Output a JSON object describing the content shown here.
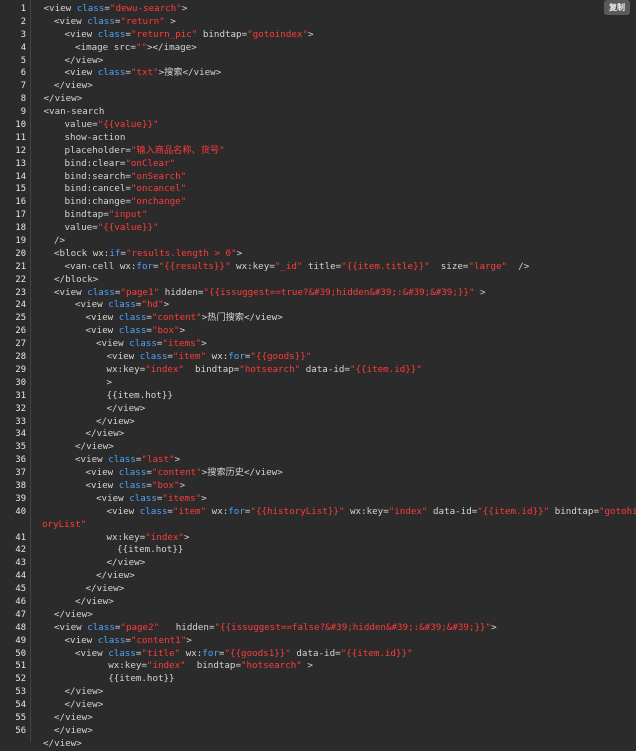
{
  "copy_label": "复制",
  "colors": {
    "background": "#2b2b2b",
    "text": "#d4d4d4",
    "keyword": "#4da3ff",
    "string": "#ff3b3b"
  },
  "lines": [
    {
      "n": "1",
      "indent": 1,
      "tokens": [
        [
          "t",
          "<view "
        ],
        [
          "k",
          "class"
        ],
        [
          "t",
          "="
        ],
        [
          "s",
          "\"dewu-search\""
        ],
        [
          "t",
          ">"
        ]
      ]
    },
    {
      "n": "2",
      "indent": 2,
      "tokens": [
        [
          "t",
          "<view "
        ],
        [
          "k",
          "class"
        ],
        [
          "t",
          "="
        ],
        [
          "s",
          "\"return\""
        ],
        [
          "t",
          " >"
        ]
      ]
    },
    {
      "n": "3",
      "indent": 3,
      "tokens": [
        [
          "t",
          "<view "
        ],
        [
          "k",
          "class"
        ],
        [
          "t",
          "="
        ],
        [
          "s",
          "\"return_pic\""
        ],
        [
          "t",
          " bindtap="
        ],
        [
          "s",
          "\"gotoindex\""
        ],
        [
          "t",
          ">"
        ]
      ]
    },
    {
      "n": "4",
      "indent": 4,
      "tokens": [
        [
          "t",
          "<image src="
        ],
        [
          "s",
          "\"\""
        ],
        [
          "t",
          "></image>"
        ]
      ]
    },
    {
      "n": "5",
      "indent": 3,
      "tokens": [
        [
          "t",
          "</view>"
        ]
      ]
    },
    {
      "n": "6",
      "indent": 3,
      "tokens": [
        [
          "t",
          "<view "
        ],
        [
          "k",
          "class"
        ],
        [
          "t",
          "="
        ],
        [
          "s",
          "\"txt\""
        ],
        [
          "t",
          ">搜索</view>"
        ]
      ]
    },
    {
      "n": "7",
      "indent": 2,
      "tokens": [
        [
          "t",
          "</view>"
        ]
      ]
    },
    {
      "n": "8",
      "indent": 1,
      "tokens": [
        [
          "t",
          "</view>"
        ]
      ]
    },
    {
      "n": "9",
      "indent": 1,
      "tokens": [
        [
          "t",
          "<van-search"
        ]
      ]
    },
    {
      "n": "10",
      "indent": 3,
      "tokens": [
        [
          "t",
          "value="
        ],
        [
          "s",
          "\"{{value}}\""
        ]
      ]
    },
    {
      "n": "11",
      "indent": 3,
      "tokens": [
        [
          "t",
          "show-action"
        ]
      ]
    },
    {
      "n": "12",
      "indent": 3,
      "tokens": [
        [
          "t",
          "placeholder="
        ],
        [
          "s",
          "\"输入商品名称、货号\""
        ]
      ]
    },
    {
      "n": "13",
      "indent": 3,
      "tokens": [
        [
          "t",
          "bind:clear="
        ],
        [
          "s",
          "\"onClear\""
        ]
      ]
    },
    {
      "n": "14",
      "indent": 3,
      "tokens": [
        [
          "t",
          "bind:search="
        ],
        [
          "s",
          "\"onSearch\""
        ]
      ]
    },
    {
      "n": "15",
      "indent": 3,
      "tokens": [
        [
          "t",
          "bind:cancel="
        ],
        [
          "s",
          "\"oncancel\""
        ]
      ]
    },
    {
      "n": "16",
      "indent": 3,
      "tokens": [
        [
          "t",
          "bind:change="
        ],
        [
          "s",
          "\"onchange\""
        ]
      ]
    },
    {
      "n": "17",
      "indent": 3,
      "tokens": [
        [
          "t",
          "bindtap="
        ],
        [
          "s",
          "\"input\""
        ]
      ]
    },
    {
      "n": "18",
      "indent": 3,
      "tokens": [
        [
          "t",
          "value="
        ],
        [
          "s",
          "\"{{value}}\""
        ]
      ]
    },
    {
      "n": "19",
      "indent": 2,
      "tokens": [
        [
          "t",
          "/>"
        ]
      ]
    },
    {
      "n": "20",
      "indent": 2,
      "tokens": [
        [
          "t",
          "<block wx:"
        ],
        [
          "k",
          "if"
        ],
        [
          "t",
          "="
        ],
        [
          "s",
          "\"results.length > 0\""
        ],
        [
          "t",
          ">"
        ]
      ]
    },
    {
      "n": "21",
      "indent": 3,
      "tokens": [
        [
          "t",
          "<van-cell wx:"
        ],
        [
          "k",
          "for"
        ],
        [
          "t",
          "="
        ],
        [
          "s",
          "\"{{results}}\""
        ],
        [
          "t",
          " wx:key="
        ],
        [
          "s",
          "\"_id\""
        ],
        [
          "t",
          " title="
        ],
        [
          "s",
          "\"{{item.title}}\""
        ],
        [
          "t",
          "  size="
        ],
        [
          "s",
          "\"large\""
        ],
        [
          "t",
          "  />"
        ]
      ]
    },
    {
      "n": "22",
      "indent": 2,
      "tokens": [
        [
          "t",
          "</block>"
        ]
      ]
    },
    {
      "n": "23",
      "indent": 2,
      "tokens": [
        [
          "t",
          "<view "
        ],
        [
          "k",
          "class"
        ],
        [
          "t",
          "="
        ],
        [
          "s",
          "\"page1\""
        ],
        [
          "t",
          " hidden="
        ],
        [
          "s",
          "\"{{issuggest==true?&#39;hidden&#39;:&#39;&#39;}}\""
        ],
        [
          "t",
          " >"
        ]
      ]
    },
    {
      "n": "24",
      "indent": 4,
      "tokens": [
        [
          "t",
          "<view "
        ],
        [
          "k",
          "class"
        ],
        [
          "t",
          "="
        ],
        [
          "s",
          "\"hd\""
        ],
        [
          "t",
          ">"
        ]
      ]
    },
    {
      "n": "25",
      "indent": 5,
      "tokens": [
        [
          "t",
          "<view "
        ],
        [
          "k",
          "class"
        ],
        [
          "t",
          "="
        ],
        [
          "s",
          "\"content\""
        ],
        [
          "t",
          ">热门搜索</view>"
        ]
      ]
    },
    {
      "n": "26",
      "indent": 5,
      "tokens": [
        [
          "t",
          "<view "
        ],
        [
          "k",
          "class"
        ],
        [
          "t",
          "="
        ],
        [
          "s",
          "\"box\""
        ],
        [
          "t",
          ">"
        ]
      ]
    },
    {
      "n": "27",
      "indent": 6,
      "tokens": [
        [
          "t",
          "<view "
        ],
        [
          "k",
          "class"
        ],
        [
          "t",
          "="
        ],
        [
          "s",
          "\"items\""
        ],
        [
          "t",
          ">"
        ]
      ]
    },
    {
      "n": "28",
      "indent": 7,
      "tokens": [
        [
          "t",
          "<view "
        ],
        [
          "k",
          "class"
        ],
        [
          "t",
          "="
        ],
        [
          "s",
          "\"item\""
        ],
        [
          "t",
          " wx:"
        ],
        [
          "k",
          "for"
        ],
        [
          "t",
          "="
        ],
        [
          "s",
          "\"{{goods}}\""
        ]
      ]
    },
    {
      "n": "29",
      "indent": 7,
      "tokens": [
        [
          "t",
          "wx:key="
        ],
        [
          "s",
          "\"index\""
        ],
        [
          "t",
          "  bindtap="
        ],
        [
          "s",
          "\"hotsearch\""
        ],
        [
          "t",
          " data-id="
        ],
        [
          "s",
          "\"{{item.id}}\""
        ]
      ]
    },
    {
      "n": "30",
      "indent": 7,
      "tokens": [
        [
          "t",
          ">"
        ]
      ]
    },
    {
      "n": "31",
      "indent": 7,
      "tokens": [
        [
          "t",
          "{{item.hot}}"
        ]
      ]
    },
    {
      "n": "32",
      "indent": 7,
      "tokens": [
        [
          "t",
          "</view>"
        ]
      ]
    },
    {
      "n": "33",
      "indent": 6,
      "tokens": [
        [
          "t",
          "</view>"
        ]
      ]
    },
    {
      "n": "34",
      "indent": 5,
      "tokens": [
        [
          "t",
          "</view>"
        ]
      ]
    },
    {
      "n": "35",
      "indent": 4,
      "tokens": [
        [
          "t",
          "</view>"
        ]
      ]
    },
    {
      "n": "36",
      "indent": 4,
      "tokens": [
        [
          "t",
          "<view "
        ],
        [
          "k",
          "class"
        ],
        [
          "t",
          "="
        ],
        [
          "s",
          "\"last\""
        ],
        [
          "t",
          ">"
        ]
      ]
    },
    {
      "n": "37",
      "indent": 5,
      "tokens": [
        [
          "t",
          "<view "
        ],
        [
          "k",
          "class"
        ],
        [
          "t",
          "="
        ],
        [
          "s",
          "\"content\""
        ],
        [
          "t",
          ">搜索历史</view>"
        ]
      ]
    },
    {
      "n": "38",
      "indent": 5,
      "tokens": [
        [
          "t",
          "<view "
        ],
        [
          "k",
          "class"
        ],
        [
          "t",
          "="
        ],
        [
          "s",
          "\"box\""
        ],
        [
          "t",
          ">"
        ]
      ]
    },
    {
      "n": "39",
      "indent": 6,
      "tokens": [
        [
          "t",
          "<view "
        ],
        [
          "k",
          "class"
        ],
        [
          "t",
          "="
        ],
        [
          "s",
          "\"items\""
        ],
        [
          "t",
          ">"
        ]
      ]
    },
    {
      "n": "40",
      "indent": 7,
      "tokens": [
        [
          "t",
          "<view "
        ],
        [
          "k",
          "class"
        ],
        [
          "t",
          "="
        ],
        [
          "s",
          "\"item\""
        ],
        [
          "t",
          " wx:"
        ],
        [
          "k",
          "for"
        ],
        [
          "t",
          "="
        ],
        [
          "s",
          "\"{{historyList}}\""
        ],
        [
          "t",
          " wx:key="
        ],
        [
          "s",
          "\"index\""
        ],
        [
          "t",
          " data-id="
        ],
        [
          "s",
          "\"{{item.id}}\""
        ],
        [
          "t",
          " bindtap="
        ],
        [
          "s",
          "\"gotohist"
        ]
      ]
    },
    {
      "n": "",
      "indent": 0,
      "tokens": [
        [
          "s",
          "oryList\""
        ]
      ]
    },
    {
      "n": "41",
      "indent": 7,
      "tokens": [
        [
          "t",
          "wx:key="
        ],
        [
          "s",
          "\"index\""
        ],
        [
          "t",
          ">"
        ]
      ]
    },
    {
      "n": "42",
      "indent": 8,
      "tokens": [
        [
          "t",
          "{{item.hot}}"
        ]
      ]
    },
    {
      "n": "43",
      "indent": 7,
      "tokens": [
        [
          "t",
          "</view>"
        ]
      ]
    },
    {
      "n": "44",
      "indent": 6,
      "tokens": [
        [
          "t",
          "</view>"
        ]
      ]
    },
    {
      "n": "45",
      "indent": 5,
      "tokens": [
        [
          "t",
          "</view>"
        ]
      ]
    },
    {
      "n": "46",
      "indent": 4,
      "tokens": [
        [
          "t",
          "</view>"
        ]
      ]
    },
    {
      "n": "47",
      "indent": 2,
      "tokens": [
        [
          "t",
          "</view>"
        ]
      ]
    },
    {
      "n": "48",
      "indent": 2,
      "tokens": [
        [
          "t",
          "<view "
        ],
        [
          "k",
          "class"
        ],
        [
          "t",
          "="
        ],
        [
          "s",
          "\"page2\""
        ],
        [
          "t",
          "   hidden="
        ],
        [
          "s",
          "\"{{issuggest==false?&#39;hidden&#39;:&#39;&#39;}}\""
        ],
        [
          "t",
          ">"
        ]
      ]
    },
    {
      "n": "49",
      "indent": 3,
      "tokens": [
        [
          "t",
          "<view "
        ],
        [
          "k",
          "class"
        ],
        [
          "t",
          "="
        ],
        [
          "s",
          "\"content1\""
        ],
        [
          "t",
          ">"
        ]
      ]
    },
    {
      "n": "50",
      "indent": 4,
      "tokens": [
        [
          "t",
          "<view "
        ],
        [
          "k",
          "class"
        ],
        [
          "t",
          "="
        ],
        [
          "s",
          "\"title\""
        ],
        [
          "t",
          " wx:"
        ],
        [
          "k",
          "for"
        ],
        [
          "t",
          "="
        ],
        [
          "s",
          "\"{{goods1}}\""
        ],
        [
          "t",
          " data-id="
        ],
        [
          "s",
          "\"{{item.id}}\""
        ]
      ]
    },
    {
      "n": "51",
      "indent": 4,
      "tokens": [
        [
          "t",
          "      wx:key="
        ],
        [
          "s",
          "\"index\""
        ],
        [
          "t",
          "  bindtap="
        ],
        [
          "s",
          "\"hotsearch\""
        ],
        [
          "t",
          " >"
        ]
      ]
    },
    {
      "n": "52",
      "indent": 4,
      "tokens": [
        [
          "t",
          "      {{item.hot}}"
        ]
      ]
    },
    {
      "n": "53",
      "indent": 3,
      "tokens": [
        [
          "t",
          "</view>"
        ]
      ]
    },
    {
      "n": "54",
      "indent": 3,
      "tokens": [
        [
          "t",
          "</view>"
        ]
      ]
    },
    {
      "n": "55",
      "indent": 2,
      "tokens": [
        [
          "t",
          "</view>"
        ]
      ]
    },
    {
      "n": "56",
      "indent": 2,
      "tokens": [
        [
          "t",
          "</view>"
        ]
      ]
    },
    {
      "n": "",
      "indent": 0.5,
      "tokens": [
        [
          "t",
          "</view>"
        ]
      ]
    }
  ]
}
